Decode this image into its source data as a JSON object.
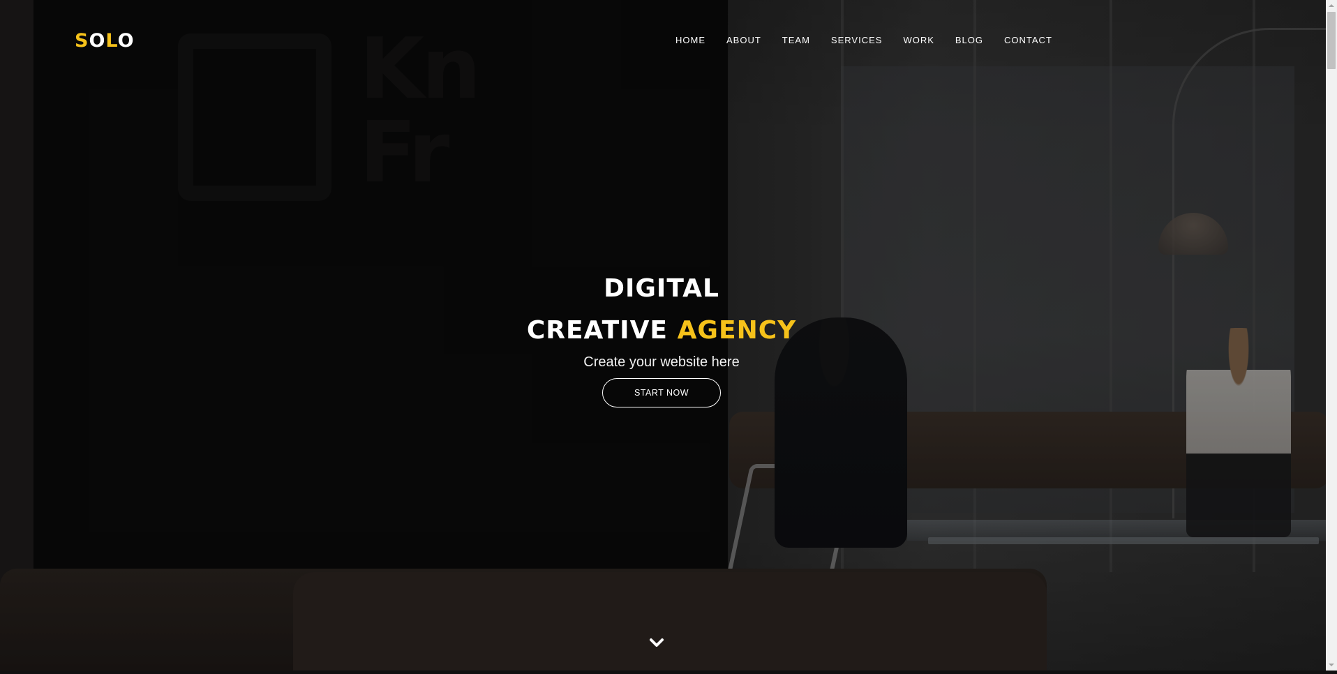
{
  "logo": {
    "letters": [
      "S",
      "O",
      "L",
      "O"
    ],
    "accent_color": "#f6c21a"
  },
  "nav": {
    "items": [
      {
        "label": "HOME"
      },
      {
        "label": "ABOUT"
      },
      {
        "label": "TEAM"
      },
      {
        "label": "SERVICES"
      },
      {
        "label": "WORK"
      },
      {
        "label": "BLOG"
      },
      {
        "label": "CONTACT"
      }
    ]
  },
  "hero": {
    "line1": "DIGITAL",
    "line2_prefix": "CREATIVE",
    "line2_accent": "AGENCY",
    "subtitle": "Create your website here",
    "cta_label": "START NOW",
    "scroll_icon": "chevron-down-icon"
  },
  "colors": {
    "accent": "#f6c21a",
    "text": "#ffffff"
  }
}
